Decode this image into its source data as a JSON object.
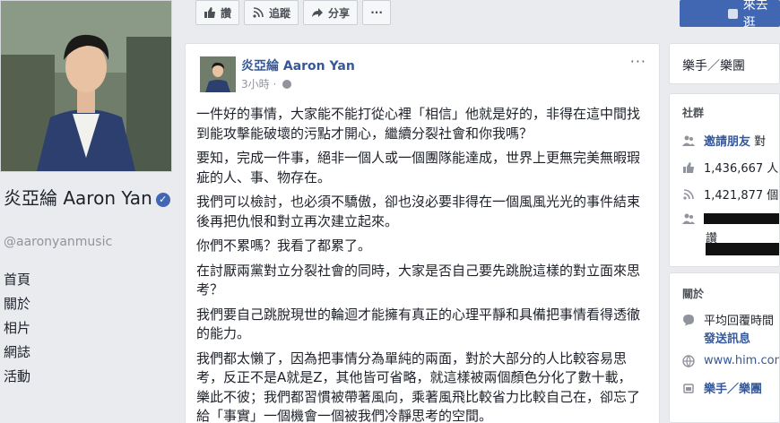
{
  "profile": {
    "name": "炎亞綸 Aaron Yan",
    "handle": "@aaronyanmusic",
    "nav": [
      "首頁",
      "關於",
      "相片",
      "網誌",
      "活動"
    ]
  },
  "actions": {
    "like": "讚",
    "follow": "追蹤",
    "share": "分享",
    "more": "···",
    "cta": "來去逛"
  },
  "post": {
    "author": "炎亞綸 Aaron Yan",
    "time": "3小時",
    "menu": "···",
    "paragraphs": [
      "一件好的事情，大家能不能打從心裡「相信」他就是好的，非得在這中間找到能攻擊能破壞的污點才開心，繼續分裂社會和你我嗎？",
      "要知，完成一件事，絕非一個人或一個團隊能達成，世界上更無完美無暇瑕疵的人、事、物存在。",
      "我們可以檢討，也必須不驕傲，卻也沒必要非得在一個風風光光的事件結束後再把仇恨和對立再次建立起來。",
      "你們不累嗎？我看了都累了。",
      "在討厭兩黨對立分裂社會的同時，大家是否自己要先跳脫這樣的對立面來思考？",
      "我們要自己跳脫現世的輪迴才能擁有真正的心理平靜和具備把事情看得透徹的能力。",
      "我們都太懶了，因為把事情分為單純的兩面，對於大部分的人比較容易思考，反正不是A就是Z，其他皆可省略，就這樣被兩個顏色分化了數十載，樂此不彼；我們都習慣被帶著風向，乘著風飛比較省力比較自己在，卻忘了給「事實」一個機會一個被我們冷靜思考的空間。"
    ]
  },
  "sidebar": {
    "category": "樂手／樂團",
    "community": {
      "title": "社群",
      "invite_label": "邀請朋友",
      "invite_suffix": "對",
      "likes": "1,436,667 人",
      "follows": "1,421,877 個",
      "friends_suffix": "讚"
    },
    "about": {
      "title": "關於",
      "reply": "平均回覆時間",
      "message": "發送訊息",
      "website": "www.him.com",
      "category": "樂手／樂團"
    }
  },
  "colors": {
    "brand": "#4267b2",
    "link": "#365899",
    "page_bg": "#e9ebee"
  },
  "icons": [
    "thumbs-up-icon",
    "rss-icon",
    "share-arrow-icon",
    "globe-icon",
    "people-icon",
    "messenger-icon",
    "website-globe-icon",
    "category-flag-icon"
  ]
}
